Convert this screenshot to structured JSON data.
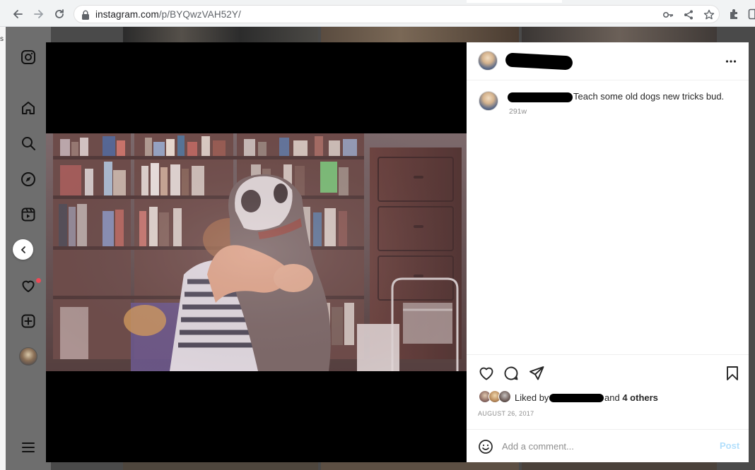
{
  "browser": {
    "url_host": "instagram.com",
    "url_path": "/p/BYQwzVAH52Y/"
  },
  "page": {
    "edge_text": "s"
  },
  "sidebar": {
    "items": [
      {
        "icon": "instagram-logo-icon"
      },
      {
        "icon": "home-icon"
      },
      {
        "icon": "search-icon"
      },
      {
        "icon": "explore-compass-icon"
      },
      {
        "icon": "reels-icon"
      },
      {
        "icon": "messenger-icon"
      },
      {
        "icon": "heart-notifications-icon"
      },
      {
        "icon": "create-plus-icon"
      },
      {
        "icon": "profile-avatar"
      },
      {
        "icon": "menu-hamburger-icon"
      }
    ],
    "notification_dot_color": "#ed4956"
  },
  "post": {
    "caption": "Teach some old dogs new tricks bud.",
    "timestamp": "291w",
    "liked_by_prefix": "Liked by",
    "liked_by_and": "and",
    "liked_by_others": "4 others",
    "date": "AUGUST 26, 2017",
    "comment_placeholder": "Add a comment...",
    "post_button": "Post",
    "post_button_color": "#b2dffc"
  },
  "colors": {
    "sidebar_bg": "#6e6e6e",
    "modal_bg": "#000000",
    "panel_bg": "#ffffff",
    "text_primary": "#262626",
    "text_secondary": "#8e8e8e"
  }
}
